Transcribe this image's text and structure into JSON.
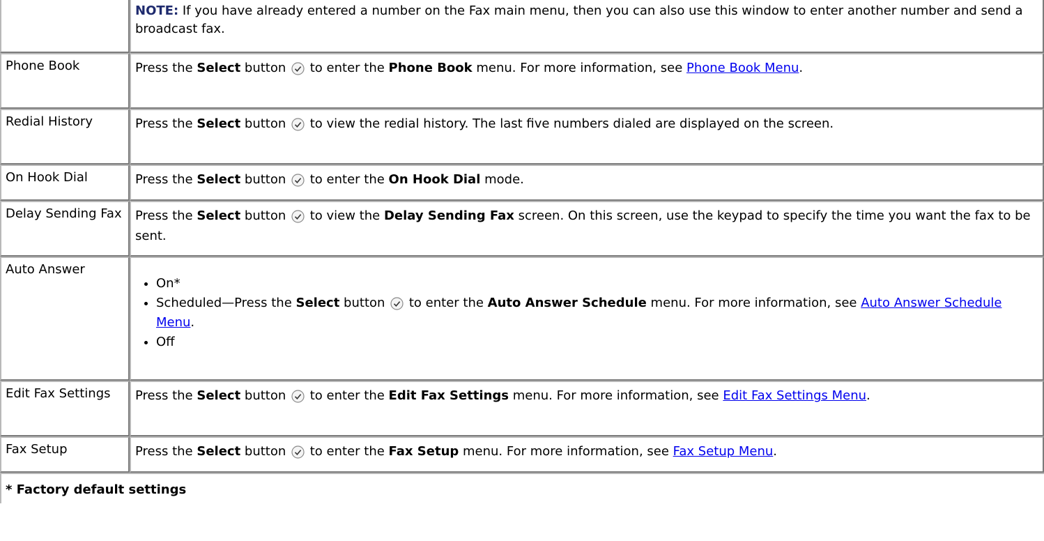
{
  "note": {
    "label": "NOTE:",
    "text": " If you have already entered a number on the Fax main menu, then you can also use this window to enter another number and send a broadcast fax."
  },
  "rows": {
    "phone_book": {
      "label": "Phone Book",
      "pre": "Press the ",
      "select": "Select",
      "mid": " button ",
      "after_icon": " to enter the ",
      "bold": "Phone Book",
      "post": " menu. For more information, see ",
      "link": "Phone Book Menu",
      "end": "."
    },
    "redial": {
      "label": "Redial History",
      "pre": "Press the ",
      "select": "Select",
      "mid": " button ",
      "after_icon": " to view the redial history. The last five numbers dialed are displayed on the screen."
    },
    "on_hook": {
      "label": "On Hook Dial",
      "pre": "Press the ",
      "select": "Select",
      "mid": " button ",
      "after_icon": " to enter the ",
      "bold": "On Hook Dial",
      "post": " mode."
    },
    "delay": {
      "label": "Delay Sending Fax",
      "pre": "Press the ",
      "select": "Select",
      "mid": " button ",
      "after_icon": " to view the ",
      "bold": "Delay Sending Fax",
      "post": " screen. On this screen, use the keypad to specify the time you want the fax to be sent."
    },
    "auto_answer": {
      "label": "Auto Answer",
      "item_on": "On*",
      "sched_pre": "Scheduled—Press the ",
      "select": "Select",
      "mid": " button ",
      "after_icon": " to enter the ",
      "bold": "Auto Answer Schedule",
      "post": " menu. For more information, see ",
      "link": "Auto Answer Schedule Menu",
      "end": ".",
      "item_off": "Off"
    },
    "edit_fax": {
      "label": "Edit Fax Settings",
      "pre": "Press the ",
      "select": "Select",
      "mid": " button ",
      "after_icon": " to enter the ",
      "bold": "Edit Fax Settings",
      "post": " menu. For more information, see ",
      "link": "Edit Fax Settings Menu",
      "end": "."
    },
    "fax_setup": {
      "label": "Fax Setup",
      "pre": "Press the ",
      "select": "Select",
      "mid": " button ",
      "after_icon": " to enter the ",
      "bold": "Fax Setup",
      "post": " menu. For more information, see ",
      "link": "Fax Setup Menu",
      "end": "."
    }
  },
  "footer": "* Factory default settings",
  "icons": {
    "select": "select-checkmark-icon"
  }
}
